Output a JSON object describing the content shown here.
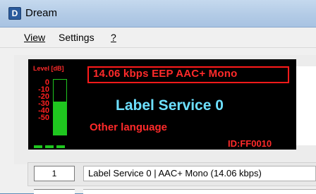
{
  "window": {
    "title": "Dream",
    "app_icon_letter": "D"
  },
  "menubar": {
    "items": [
      "View",
      "Settings",
      "?"
    ]
  },
  "display": {
    "level_label": "Level [dB]",
    "scale_ticks": [
      "0",
      "-10",
      "-20",
      "-30",
      "-40",
      "-50"
    ],
    "level_fraction": 0.6,
    "info": "14.06 kbps EEP  AAC+  Mono",
    "service_label": "Label Service 0",
    "language": "Other language",
    "id": "ID:FF0010",
    "colors": {
      "background": "#000000",
      "accent_red": "#ff2a2a",
      "service_cyan": "#6de0ff",
      "meter_green": "#1fc61f"
    }
  },
  "services": [
    {
      "number": "1",
      "description": "Label Service 0  |  AAC+ Mono (14.06 kbps)"
    }
  ]
}
